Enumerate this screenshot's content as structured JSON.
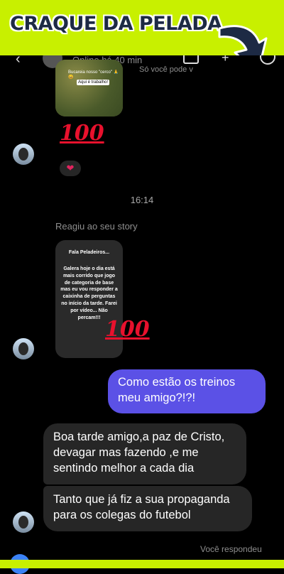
{
  "banner": {
    "title": "CRAQUE DA PELADA"
  },
  "header": {
    "status": "Online há 40 min",
    "story_reply_faded": "Só você pode v"
  },
  "top_story": {
    "line1": "Bucareia nosso \"cerco\" 🙏😀",
    "line2": "Aqui é trabalho!"
  },
  "reactions": {
    "emoji_100": "💯",
    "emoji_100_b": "💯",
    "heart": "❤️"
  },
  "timestamp": "16:14",
  "story_reaction_label": "Reagiu ao seu story",
  "story_card": {
    "title": "Fala Peladeiros...",
    "body": "Galera hoje o dia está mais corrido que jogo de categoria de base mas eu vou responder a caixinha de perguntas no início da tarde. Farei por vídeo... Não percam!!!"
  },
  "messages": [
    {
      "from": "me",
      "text": "Como estão os treinos meu amigo?!?!"
    },
    {
      "from": "them",
      "text": "Boa tarde amigo,a paz de Cristo, devagar mas fazendo ,e me sentindo melhor a cada dia"
    },
    {
      "from": "them",
      "text": "Tanto que já fiz a sua propaganda para os colegas do futebol"
    }
  ],
  "footer": {
    "you_replied": "Você respondeu"
  },
  "colors": {
    "banner": "#c8f000",
    "outgoing": "#5b51e6",
    "incoming": "#262626"
  }
}
